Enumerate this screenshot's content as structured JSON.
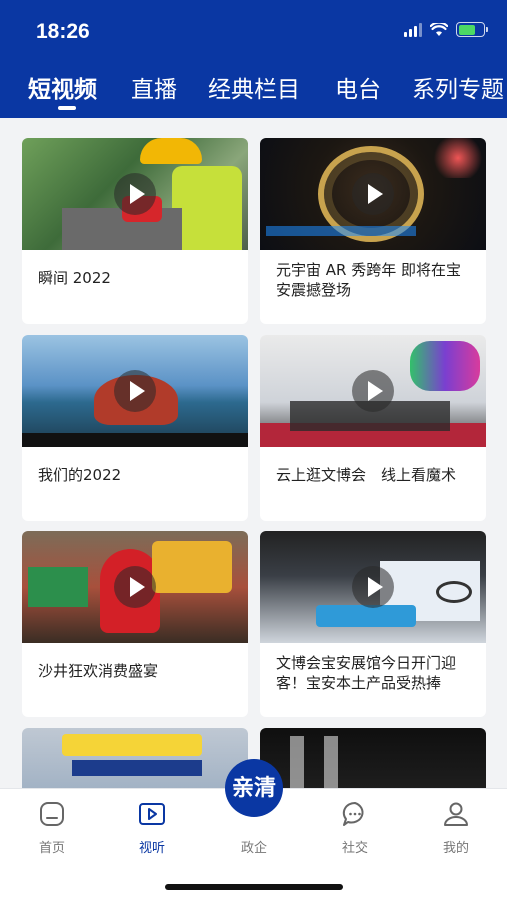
{
  "status_bar": {
    "time": "18:26"
  },
  "tabs": [
    {
      "label": "短视频",
      "active": true
    },
    {
      "label": "直播",
      "active": false
    },
    {
      "label": "经典栏目",
      "active": false
    },
    {
      "label": "电台",
      "active": false
    },
    {
      "label": "系列专题",
      "active": false
    }
  ],
  "videos": [
    {
      "title": "瞬间 2022"
    },
    {
      "title": "元宇宙 AR 秀跨年 即将在宝安震撼登场"
    },
    {
      "title": "我们的2022"
    },
    {
      "title": "云上逛文博会　线上看魔术"
    },
    {
      "title": "沙井狂欢消费盛宴"
    },
    {
      "title": "文博会宝安展馆今日开门迎客！宝安本土产品受热捧"
    },
    {
      "title": ""
    },
    {
      "title": ""
    }
  ],
  "bottom_nav": {
    "items": [
      {
        "label": "首页",
        "icon": "home-icon"
      },
      {
        "label": "视听",
        "icon": "play-screen-icon",
        "active": true
      },
      {
        "label": "政企",
        "icon": "qinqing-logo"
      },
      {
        "label": "社交",
        "icon": "chat-bubble-icon"
      },
      {
        "label": "我的",
        "icon": "user-icon"
      }
    ],
    "center_text": "亲清"
  },
  "colors": {
    "brand": "#0a37a3",
    "background": "#f2f3f5"
  }
}
